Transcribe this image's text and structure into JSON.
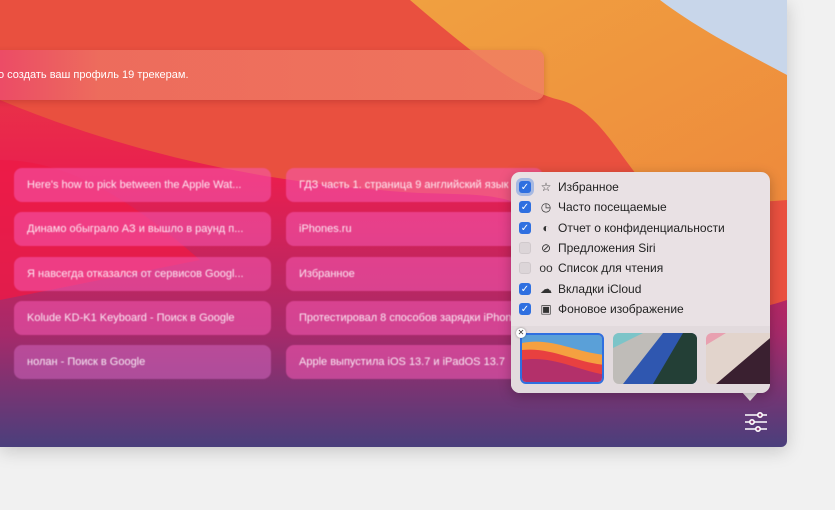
{
  "banner": {
    "text": "о создать ваш профиль 19 трекерам."
  },
  "tiles": [
    "Here's how to pick between the Apple Wat...",
    "ГДЗ часть 1. страница 9 английский язык",
    "Динамо обыграло АЗ и вышло в раунд п...",
    "iPhones.ru",
    "Я навсегда отказался от сервисов Googl...",
    "Избранное",
    "Kolude KD-K1 Keyboard - Поиск в Google",
    "Протестировал 8 способов зарядки iPhone",
    "нолан - Поиск в Google",
    "Apple выпустила iOS 13.7 и iPadOS 13.7"
  ],
  "menu": {
    "items": [
      {
        "label": "Избранное",
        "checked": true,
        "icon": "star-icon"
      },
      {
        "label": "Часто посещаемые",
        "checked": true,
        "icon": "clock-icon"
      },
      {
        "label": "Отчет о конфиденциальности",
        "checked": true,
        "icon": "shield-icon"
      },
      {
        "label": "Предложения Siri",
        "checked": false,
        "icon": "compass-icon"
      },
      {
        "label": "Список для чтения",
        "checked": false,
        "icon": "glasses-icon"
      },
      {
        "label": "Вкладки iCloud",
        "checked": true,
        "icon": "cloud-icon"
      },
      {
        "label": "Фоновое изображение",
        "checked": true,
        "icon": "image-icon"
      }
    ]
  },
  "colors": {
    "accent": "#2f6fe0",
    "popover": "#e9e1e4"
  }
}
